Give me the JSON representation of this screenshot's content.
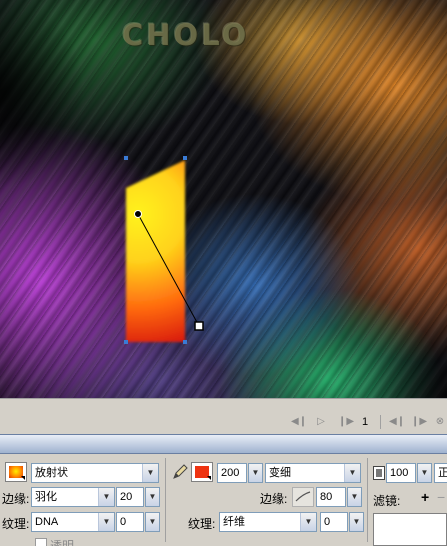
{
  "canvas": {
    "logo_text": "CHOLO"
  },
  "timeline": {
    "frame_number": "1"
  },
  "fill": {
    "color": "#ff8a00",
    "type": "放射状",
    "edge_label": "边缘:",
    "edge_value": "羽化",
    "edge_size": "20",
    "texture_label": "纹理:",
    "texture_value": "DNA",
    "texture_amount": "0",
    "transparent_label": "透明"
  },
  "stroke": {
    "color": "#ee3311",
    "width": "200",
    "type": "变细",
    "edge_label": "边缘:",
    "edge_value": "80",
    "texture_label": "纹理:",
    "texture_value": "纤维",
    "texture_amount": "0"
  },
  "effects": {
    "opacity": "100",
    "mode": "正",
    "filter_label": "滤镜:",
    "add_symbol": "+",
    "remove_symbol": "−"
  },
  "icons": {
    "pencil": "pencil-icon",
    "opacity": "opacity-icon",
    "edge_stroke": "edge-stroke-icon"
  }
}
